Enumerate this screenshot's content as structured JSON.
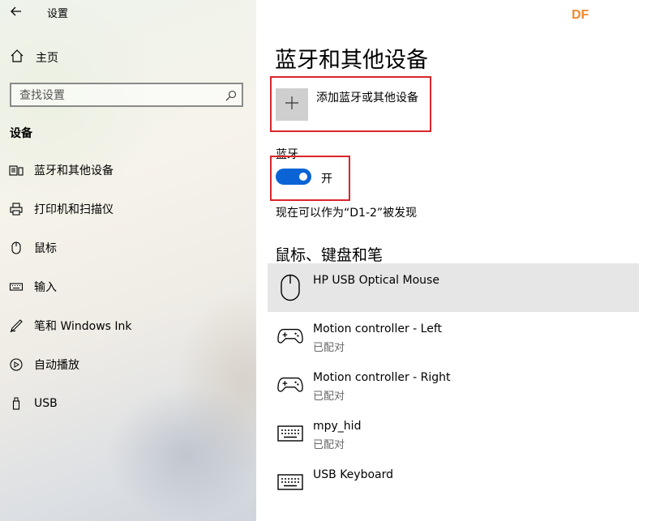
{
  "sidebar": {
    "app_title": "设置",
    "home_label": "主页",
    "search_placeholder": "查找设置",
    "section_title": "设备",
    "items": [
      {
        "label": "蓝牙和其他设备",
        "icon": "bluetooth-devices-icon"
      },
      {
        "label": "打印机和扫描仪",
        "icon": "printer-icon"
      },
      {
        "label": "鼠标",
        "icon": "mouse-icon"
      },
      {
        "label": "输入",
        "icon": "keyboard-icon"
      },
      {
        "label": "笔和 Windows Ink",
        "icon": "pen-icon"
      },
      {
        "label": "自动播放",
        "icon": "autoplay-icon"
      },
      {
        "label": "USB",
        "icon": "usb-icon"
      }
    ]
  },
  "watermark": "DF",
  "main": {
    "title": "蓝牙和其他设备",
    "add_device_label": "添加蓝牙或其他设备",
    "bluetooth_label": "蓝牙",
    "toggle_state": "开",
    "discoverable_text": "现在可以作为“D1-2”被发现",
    "section_heading": "鼠标、键盘和笔",
    "devices": [
      {
        "name": "HP USB Optical Mouse",
        "status": "",
        "icon": "mouse-icon"
      },
      {
        "name": "Motion controller - Left",
        "status": "已配对",
        "icon": "gamepad-icon"
      },
      {
        "name": "Motion controller - Right",
        "status": "已配对",
        "icon": "gamepad-icon"
      },
      {
        "name": "mpy_hid",
        "status": "已配对",
        "icon": "keyboard-icon"
      },
      {
        "name": "USB Keyboard",
        "status": "",
        "icon": "keyboard-icon"
      }
    ]
  },
  "colors": {
    "accent": "#0a64d6",
    "highlight_box": "#d9262b",
    "watermark": "#f08a2c",
    "selected_row": "#e6e6e6"
  }
}
